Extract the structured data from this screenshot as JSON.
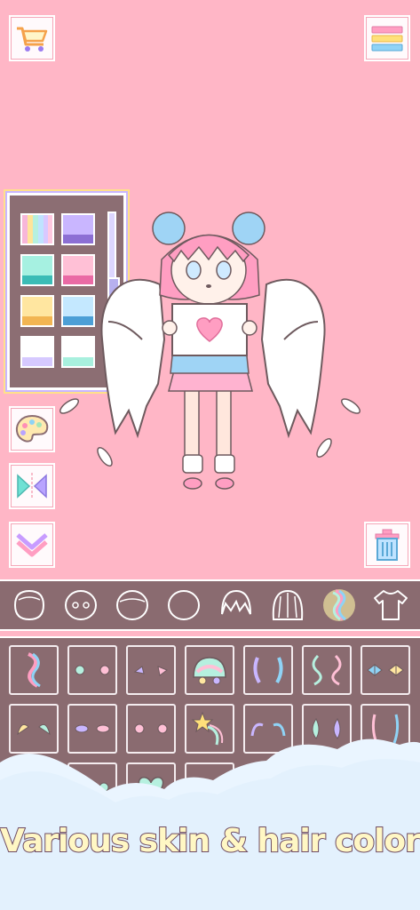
{
  "toolbar": {
    "shop_icon": "shopping-cart-icon",
    "menu_icon": "menu-lines-icon",
    "palette_icon": "palette-icon",
    "flip_icon": "flip-icon",
    "collapse_icon": "chevron-down-double-icon",
    "trash_icon": "trash-icon"
  },
  "color_panel": {
    "swatches": [
      {
        "top": "#f5c7e3",
        "bottom": "#a9f0e4",
        "pattern": "rainbow"
      },
      {
        "top": "#c9b6ff",
        "bottom": "#8c6fd4"
      },
      {
        "top": "#a6f1e1",
        "bottom": "#3bbcb6"
      },
      {
        "top": "#ffc0d6",
        "bottom": "#ea6aa5"
      },
      {
        "top": "#ffe6a0",
        "bottom": "#f2b552"
      },
      {
        "top": "#c4e8ff",
        "bottom": "#4c9fd6"
      },
      {
        "top": "#ffffff",
        "bottom": "#d6c9ff"
      },
      {
        "top": "#ffffff",
        "bottom": "#a8f0de"
      }
    ],
    "slider_level": 0.6
  },
  "categories": [
    {
      "name": "face-shape-1",
      "selected": false
    },
    {
      "name": "face-shape-2",
      "selected": false
    },
    {
      "name": "face-shape-3",
      "selected": false
    },
    {
      "name": "face-shape-4",
      "selected": false
    },
    {
      "name": "hair-front",
      "selected": false
    },
    {
      "name": "hair-back",
      "selected": false
    },
    {
      "name": "hair-accessory",
      "selected": true
    },
    {
      "name": "clothes",
      "selected": false
    }
  ],
  "caption": "Various skin & hair color",
  "colors": {
    "background": "#ffb6c6",
    "panel": "#8a6b70",
    "accent_pink": "#ff9ec2",
    "accent_blue": "#9fd4f5"
  }
}
